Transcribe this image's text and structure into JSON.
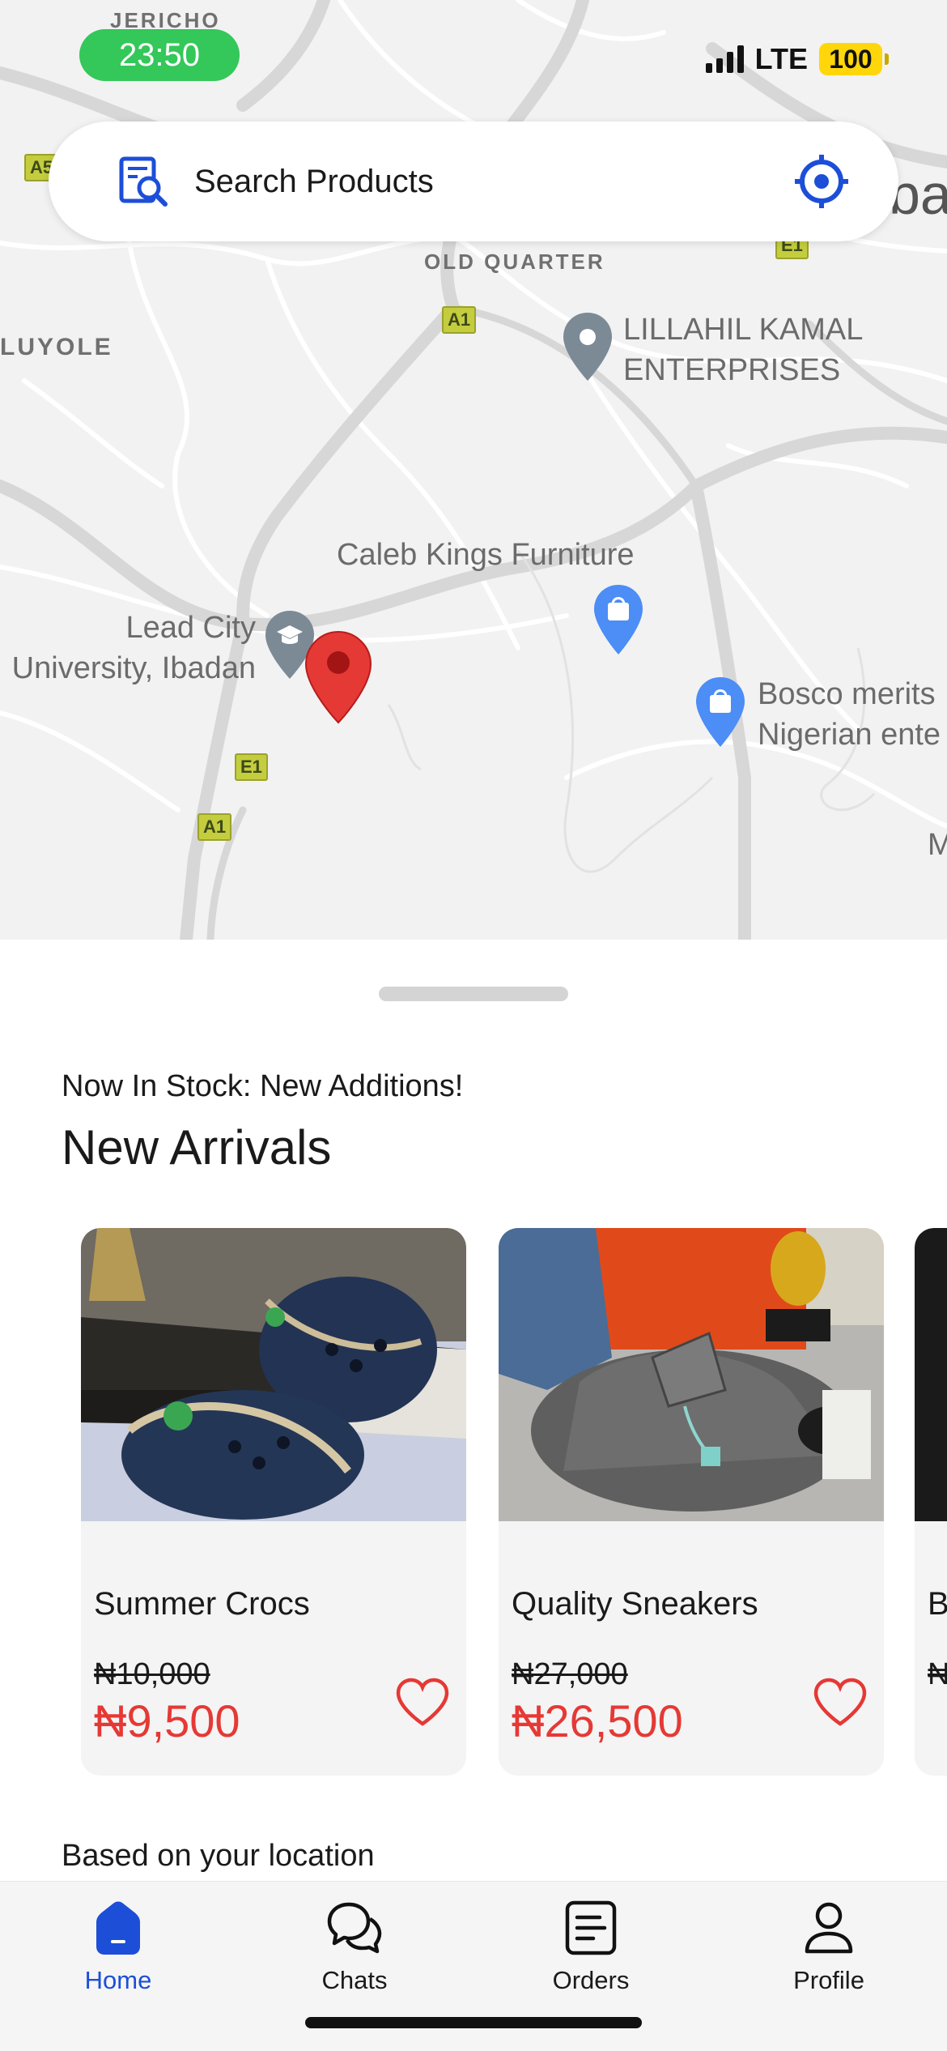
{
  "status_bar": {
    "time": "23:50",
    "network": "LTE",
    "battery": "100"
  },
  "search": {
    "placeholder": "Search Products"
  },
  "map": {
    "labels": {
      "jericho": "JERICHO",
      "old_quarter": "OLD QUARTER",
      "oluyole": "LUYOLE",
      "lillahil_line1": "LILLAHIL KAMAL",
      "lillahil_line2": "ENTERPRISES",
      "caleb": "Caleb Kings Furniture",
      "lead_line1": "Lead City",
      "lead_line2": "University, Ibadan",
      "bosco_line1": "Bosco merits",
      "bosco_line2": "Nigerian ente",
      "ba": "ba",
      "m": "M"
    },
    "shields": [
      "A5",
      "A1",
      "E1",
      "E1",
      "A1"
    ]
  },
  "sheet": {
    "subtitle": "Now In Stock: New Additions!",
    "title": "New Arrivals",
    "section2": "Based on your location",
    "products": [
      {
        "name": "Summer Crocs",
        "old_price": "₦10,000",
        "price": "₦9,500"
      },
      {
        "name": "Quality Sneakers",
        "old_price": "₦27,000",
        "price": "₦26,500"
      },
      {
        "name": "B co",
        "old_price": "₦",
        "price": ""
      }
    ]
  },
  "tabs": [
    {
      "label": "Home",
      "active": true
    },
    {
      "label": "Chats",
      "active": false
    },
    {
      "label": "Orders",
      "active": false
    },
    {
      "label": "Profile",
      "active": false
    }
  ],
  "colors": {
    "accent": "#1d4ed8",
    "price": "#e53935",
    "pin": "#e53935",
    "status_time_bg": "#34c759"
  }
}
